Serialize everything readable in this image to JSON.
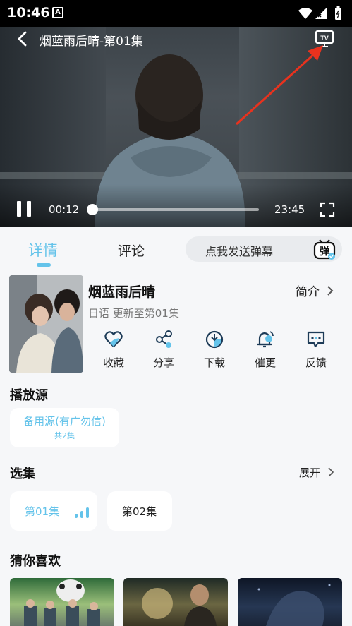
{
  "status_bar": {
    "time": "10:46",
    "notification_glyph": "A"
  },
  "player": {
    "title": "烟蓝雨后晴-第01集",
    "current_time": "00:12",
    "total_time": "23:45",
    "progress_fraction": 0.01,
    "tv_label": "TV"
  },
  "tabs": {
    "details": "详情",
    "comments": "评论"
  },
  "danmu": {
    "placeholder": "点我发送弹幕",
    "icon_text": "弹"
  },
  "show": {
    "title": "烟蓝雨后晴",
    "meta": "日语 更新至第01集",
    "intro": "简介"
  },
  "actions": [
    {
      "label": "收藏",
      "icon": "heart-icon"
    },
    {
      "label": "分享",
      "icon": "share-icon"
    },
    {
      "label": "下载",
      "icon": "download-icon"
    },
    {
      "label": "催更",
      "icon": "bell-icon"
    },
    {
      "label": "反馈",
      "icon": "feedback-icon"
    }
  ],
  "source_section": {
    "title": "播放源",
    "name": "备用源(有广勿信)",
    "count": "共2集"
  },
  "episodes_section": {
    "title": "选集",
    "expand": "展开",
    "episodes": [
      "第01集",
      "第02集"
    ]
  },
  "recommend_section": {
    "title": "猜你喜欢"
  },
  "colors": {
    "accent": "#64c3ea",
    "arrow": "#e8321e"
  }
}
